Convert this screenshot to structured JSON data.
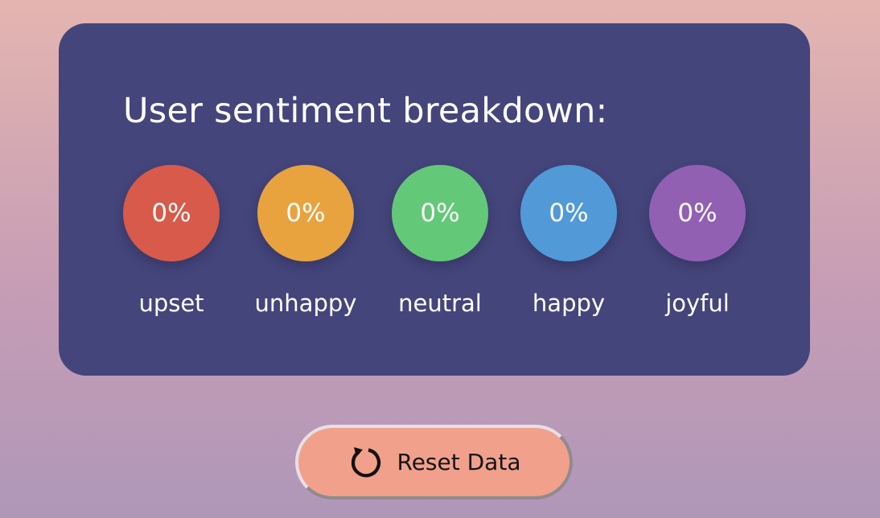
{
  "card": {
    "title": "User sentiment breakdown:"
  },
  "sentiments": [
    {
      "label": "upset",
      "value": "0%",
      "color": "#d75a4a"
    },
    {
      "label": "unhappy",
      "value": "0%",
      "color": "#e8a33f"
    },
    {
      "label": "neutral",
      "value": "0%",
      "color": "#63c978"
    },
    {
      "label": "happy",
      "value": "0%",
      "color": "#5299d8"
    },
    {
      "label": "joyful",
      "value": "0%",
      "color": "#9160b3"
    }
  ],
  "reset_button": {
    "label": "Reset Data",
    "icon": "refresh-icon"
  },
  "colors": {
    "card_background": "#44457b",
    "button_background": "#f1a08c"
  }
}
